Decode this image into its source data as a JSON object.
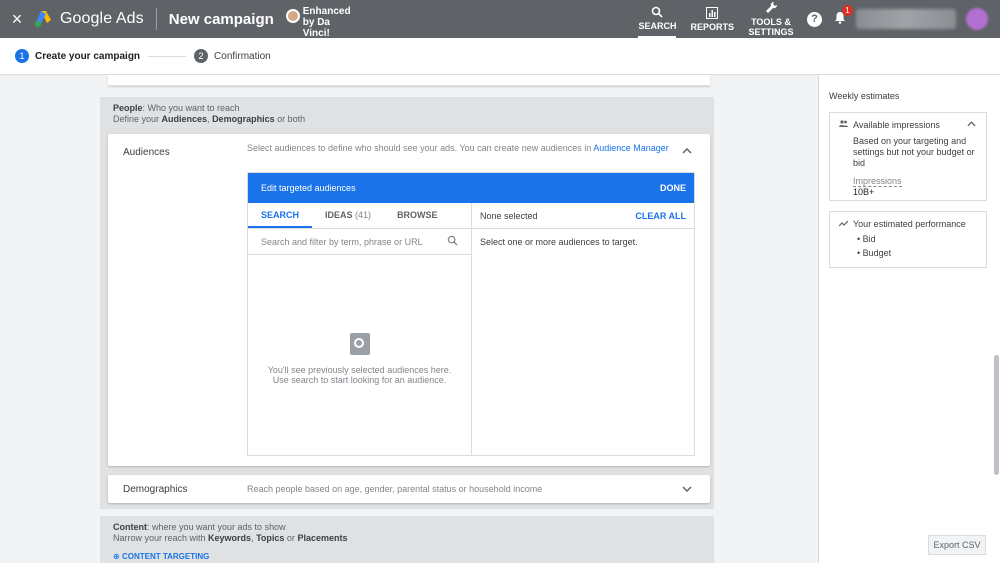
{
  "header": {
    "close_icon": "×",
    "brand": "Google Ads",
    "campaign": "New campaign",
    "extension": "Enhanced by Da Vinci!",
    "tools": [
      {
        "label": "SEARCH",
        "icon": "search-icon"
      },
      {
        "label": "REPORTS",
        "icon": "bar-chart-icon"
      },
      {
        "label": "TOOLS & SETTINGS",
        "icon": "wrench-icon"
      }
    ],
    "help_glyph": "?",
    "notif_count": "1"
  },
  "stepper": {
    "steps": [
      {
        "num": "1",
        "label": "Create your campaign"
      },
      {
        "num": "2",
        "label": "Confirmation"
      }
    ]
  },
  "people": {
    "heading": "People",
    "heading_rest": ": Who you want to reach",
    "sub_pre": "Define your ",
    "sub_b1": "Audiences",
    "sub_mid": ", ",
    "sub_b2": "Demographics",
    "sub_post": " or both"
  },
  "audiences": {
    "label": "Audiences",
    "desc": "Select audiences to define who should see your ads.  You can create new audiences in ",
    "desc_link": "Audience Manager",
    "editor_title": "Edit targeted audiences",
    "done": "DONE",
    "tabs": [
      {
        "label": "SEARCH",
        "count": ""
      },
      {
        "label": "IDEAS",
        "count": "(41)"
      },
      {
        "label": "BROWSE",
        "count": ""
      }
    ],
    "search_placeholder": "Search and filter by term, phrase or URL",
    "empty_line1": "You'll see previously selected audiences here.",
    "empty_line2": "Use search to start looking for an audience.",
    "selected_label": "None selected",
    "clear_all": "CLEAR ALL",
    "selected_msg": "Select one or more audiences to target."
  },
  "demographics": {
    "label": "Demographics",
    "desc": "Reach people based on age, gender, parental status or household income"
  },
  "content": {
    "heading": "Content",
    "heading_rest": ": where you want your ads to show",
    "sub_pre": "Narrow your reach with ",
    "sub_b1": "Keywords",
    "sub_mid": ", ",
    "sub_b2": "Topics",
    "sub_mid2": " or ",
    "sub_b3": "Placements",
    "link": "CONTENT TARGETING"
  },
  "estimates": {
    "title": "Weekly estimates",
    "impressions_title": "Available impressions",
    "impressions_desc": "Based on your targeting and settings but not your budget or bid",
    "impressions_label": "Impressions",
    "impressions_value": "10B+",
    "performance_title": "Your estimated performance",
    "performance_items": [
      "Bid",
      "Budget"
    ]
  },
  "export_csv": "Export CSV",
  "colors": {
    "accent": "#1a73e8",
    "topbar": "#5f6368",
    "badge": "#d93025"
  }
}
